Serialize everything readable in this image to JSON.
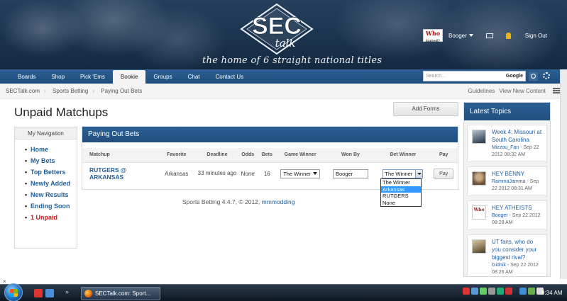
{
  "header": {
    "logo_text_main": "SEC",
    "logo_text_sub": "talk",
    "tagline": "the home of 6 straight national titles",
    "who_badge": "Who",
    "username": "Booger",
    "sign_out": "Sign Out"
  },
  "nav": {
    "items": [
      {
        "label": "Boards"
      },
      {
        "label": "Shop"
      },
      {
        "label": "Pick 'Ems"
      },
      {
        "label": "Bookie"
      },
      {
        "label": "Groups"
      },
      {
        "label": "Chat"
      },
      {
        "label": "Contact Us"
      }
    ],
    "active": "Bookie",
    "search_placeholder": "Search...",
    "search_engine": "Google"
  },
  "breadcrumb": {
    "items": [
      "SECTalk.com",
      "Sports Betting",
      "Paying Out Bets"
    ],
    "right_links": [
      "Guidelines",
      "View New Content"
    ]
  },
  "page": {
    "title": "Unpaid Matchups",
    "add_forms_label": "Add Forms"
  },
  "my_navigation": {
    "title": "My Navigation",
    "items": [
      {
        "label": "Home"
      },
      {
        "label": "My Bets"
      },
      {
        "label": "Top Betters"
      },
      {
        "label": "Newly Added"
      },
      {
        "label": "New Results"
      },
      {
        "label": "Ending Soon"
      },
      {
        "label": "1 Unpaid"
      }
    ]
  },
  "paying_out": {
    "title": "Paying Out Bets",
    "columns": [
      "Matchup",
      "Favorite",
      "Deadline",
      "Odds",
      "Bets",
      "Game Winner",
      "Won By",
      "Bet Winner",
      "Pay"
    ],
    "row": {
      "matchup": "RUTGERS @ ARKANSAS",
      "favorite": "Arkansas",
      "deadline": "33 minutes ago",
      "odds": "None",
      "bets": "16",
      "game_winner": "The Winner",
      "won_by": "Booger",
      "bet_winner": "The Winner",
      "pay_label": "Pay"
    },
    "bet_winner_options": [
      "The Winner",
      "Arkansas",
      "RUTGERS",
      "None"
    ],
    "highlighted_option": "Arkansas"
  },
  "footer": {
    "credit_prefix": "Sports Betting 4.4.7, © 2012,",
    "credit_link": "mmmodding"
  },
  "latest_topics": {
    "title": "Latest Topics",
    "items": [
      {
        "title": "Week 4: Missouri at South Carolina",
        "user": "Mizzou_Fan",
        "date": " - Sep 22 2012 08:32 AM"
      },
      {
        "title": "HEY BENNY",
        "user": "RammaJamma",
        "date": " - Sep 22 2012 08:31 AM"
      },
      {
        "title": "HEY ATHEISTS",
        "user": "Booger",
        "date": " - Sep 22 2012 08:28 AM"
      },
      {
        "title": "UT fans, who do you consider your biggest rival?",
        "user": "Gidnik",
        "date": " - Sep 22 2012 08:26 AM"
      }
    ]
  },
  "taskbar": {
    "task_label": "SECTalk.com: Sport...",
    "clock": "9:34 AM"
  }
}
